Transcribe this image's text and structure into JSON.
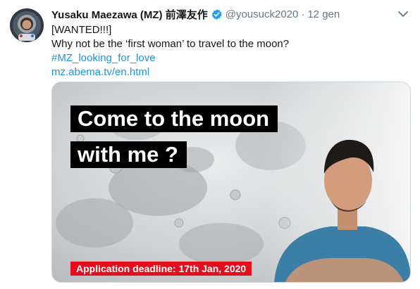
{
  "tweet": {
    "display_name": "Yusaku Maezawa (MZ) 前澤友作",
    "handle": "@yousuck2020",
    "separator": "·",
    "time": "12 gen",
    "lines": [
      "[WANTED!!!]",
      "Why not be the ‘first woman’ to travel to the moon?"
    ],
    "hashtag": "#MZ_looking_for_love",
    "url": "mz.abema.tv/en.html"
  },
  "media": {
    "headline_line1": "Come to the moon",
    "headline_line2": "with me ?",
    "deadline": "Application deadline: 17th Jan, 2020"
  },
  "icons": {
    "verified": "verified-badge-icon",
    "caret": "chevron-down-icon",
    "avatar": "avatar"
  },
  "colors": {
    "link": "#1b95e0",
    "verified": "#1da1f2",
    "deadline_bg": "#e30d1b",
    "headline_bg": "#000000",
    "muted_text": "#657786"
  }
}
